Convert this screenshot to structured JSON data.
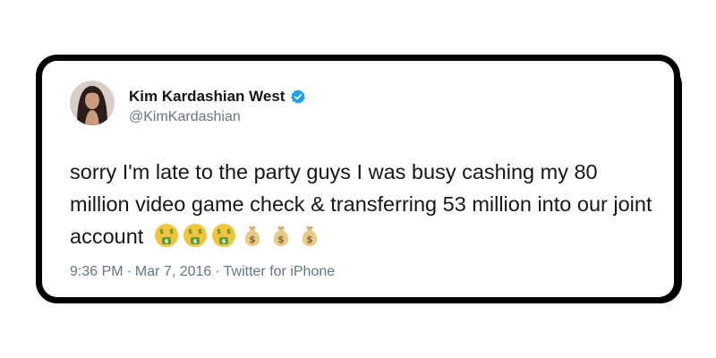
{
  "tweet": {
    "author": {
      "name": "Kim Kardashian West",
      "handle": "@KimKardashian",
      "verified": true
    },
    "text": "sorry I'm late to the party guys I was busy cashing my 80 million video game check & transferring 53 million into our joint account",
    "emojis": [
      "money-mouth-face-icon",
      "money-mouth-face-icon",
      "money-mouth-face-icon",
      "money-bag-icon",
      "money-bag-icon",
      "money-bag-icon"
    ],
    "time": "9:36 PM",
    "date": "Mar 7, 2016",
    "source": "Twitter for iPhone",
    "separator": "·"
  },
  "colors": {
    "text": "#14171a",
    "secondary": "#657786",
    "verified": "#1da1f2",
    "card_border": "#000000"
  }
}
